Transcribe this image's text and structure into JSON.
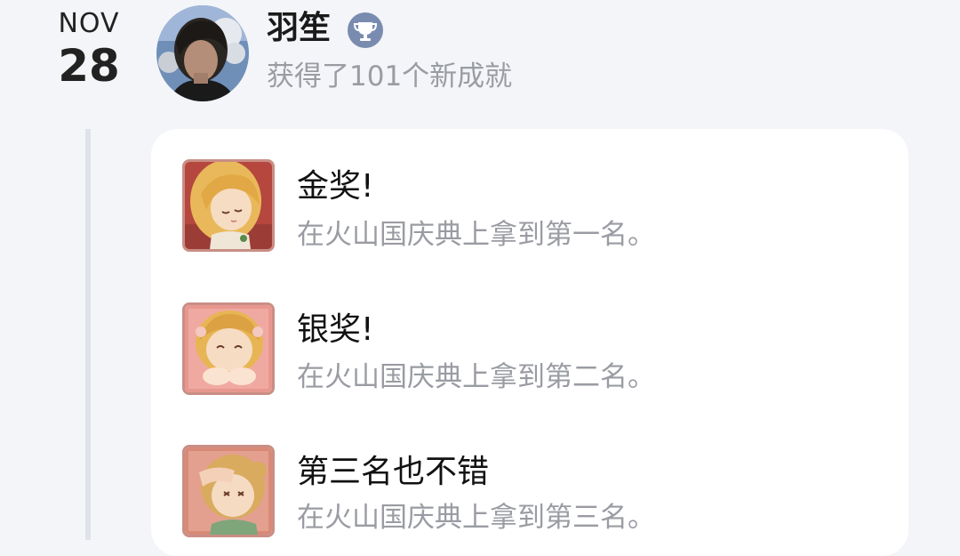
{
  "date": {
    "month": "NOV",
    "day": "28"
  },
  "user": {
    "name": "羽笙",
    "summary": "获得了101个新成就",
    "badge_icon": "trophy-icon"
  },
  "achievements": [
    {
      "title": "金奖!",
      "description": "在火山国庆典上拿到第一名。",
      "icon": "character-gold-icon"
    },
    {
      "title": "银奖!",
      "description": "在火山国庆典上拿到第二名。",
      "icon": "character-silver-icon"
    },
    {
      "title": "第三名也不错",
      "description": "在火山国庆典上拿到第三名。",
      "icon": "character-bronze-icon"
    }
  ],
  "colors": {
    "background": "#f4f5f8",
    "card": "#ffffff",
    "muted_text": "#9a9ca3",
    "badge": "#7a8bb0",
    "timeline": "#dfe2e8"
  }
}
